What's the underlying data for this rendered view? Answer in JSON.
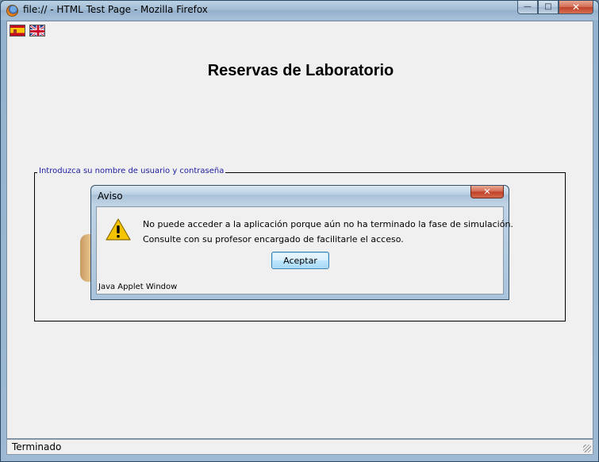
{
  "browser": {
    "window_title": "file:// - HTML Test Page - Mozilla Firefox",
    "minimize_glyph": "—",
    "maximize_glyph": "□",
    "close_glyph": "✕",
    "status_text": "Terminado"
  },
  "page": {
    "flags": [
      {
        "lang": "es",
        "icon": "spain-flag-icon"
      },
      {
        "lang": "en",
        "icon": "uk-flag-icon"
      }
    ],
    "title": "Reservas de Laboratorio",
    "login_legend": "Introduzca su nombre de usuario y contraseña"
  },
  "dialog": {
    "title": "Aviso",
    "close_glyph": "✕",
    "icon": "warning-icon",
    "message_line1": "No puede acceder a la aplicación porque aún no ha terminado la fase de simulación.",
    "message_line2": "Consulte con su profesor encargado de facilitarle el acceso.",
    "ok_label": "Aceptar",
    "applet_warning": "Java Applet Window"
  },
  "colors": {
    "legend_text": "#1c1ca0",
    "warning_yellow": "#f5c400"
  }
}
